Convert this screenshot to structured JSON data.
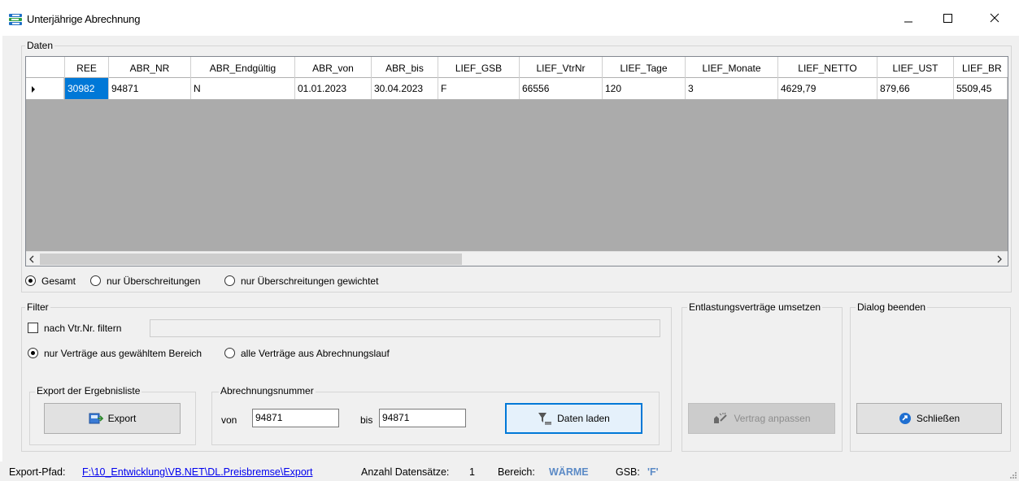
{
  "window": {
    "title": "Unterjährige Abrechnung",
    "icon": "app-icon",
    "controls": {
      "minimize": "—",
      "maximize": "☐",
      "close": "✕"
    }
  },
  "daten_group": {
    "label": "Daten"
  },
  "grid": {
    "columns": [
      "REE",
      "ABR_NR",
      "ABR_Endgültig",
      "ABR_von",
      "ABR_bis",
      "LIEF_GSB",
      "LIEF_VtrNr",
      "LIEF_Tage",
      "LIEF_Monate",
      "LIEF_NETTO",
      "LIEF_UST",
      "LIEF_BR"
    ],
    "rows": [
      [
        "30982",
        "94871",
        "N",
        "01.01.2023",
        "30.04.2023",
        "F",
        "66556",
        "120",
        "3",
        "4629,79",
        "879,66",
        "5509,45"
      ]
    ],
    "row_indicator": "▶",
    "scroll_left": "<",
    "scroll_right": ">"
  },
  "view_options": {
    "gesamt": "Gesamt",
    "nur_ueberschreitungen": "nur Überschreitungen",
    "nur_ueberschreitungen_gewichtet": "nur Überschreitungen gewichtet",
    "selected": "gesamt"
  },
  "filter": {
    "label": "Filter",
    "vtr_checkbox_label": "nach Vtr.Nr. filtern",
    "vtr_value": "",
    "nur_bereich": "nur Verträge aus gewähltem Bereich",
    "alle_vertraege": "alle Verträge aus Abrechnungslauf",
    "selected": "nur_bereich"
  },
  "export_group": {
    "label": "Export der Ergebnisliste",
    "button": "Export"
  },
  "abrechnung_group": {
    "label": "Abrechnungsnummer",
    "von_label": "von",
    "von_value": "94871",
    "bis_label": "bis",
    "bis_value": "94871",
    "load_button": "Daten laden"
  },
  "entlastung_group": {
    "label": "Entlastungsverträge umsetzen",
    "button": "Vertrag anpassen"
  },
  "dialog_group": {
    "label": "Dialog beenden",
    "button": "Schließen"
  },
  "status": {
    "export_label": "Export-Pfad:",
    "export_path": "F:\\10_Entwicklung\\VB.NET\\DL.Preisbremse\\Export",
    "count_label": "Anzahl Datensätze:",
    "count_value": "1",
    "bereich_label": "Bereich:",
    "bereich_value": "WÄRME",
    "gsb_label": "GSB:",
    "gsb_value": "'F'"
  }
}
